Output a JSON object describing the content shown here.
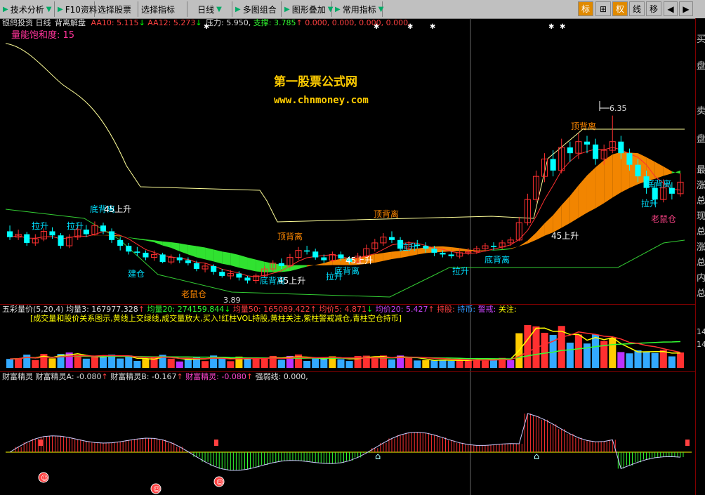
{
  "toolbar": {
    "items": [
      "技术分析",
      "F10资料",
      "选择股票",
      "选择指标",
      "日线",
      "多图组合",
      "图形叠加",
      "常用指标"
    ],
    "right_tools": [
      "标",
      "⊞",
      "权",
      "线",
      "移",
      "◀",
      "▶"
    ]
  },
  "main_chart": {
    "stock_name": "银鸽投资",
    "period": "日线",
    "indicator_name": "背离解盘",
    "aa10_label": "AA10:",
    "aa10_value": "5.115",
    "aa12_label": "AA12:",
    "aa12_value": "5.273",
    "pressure_label": "压力:",
    "pressure_value": "5.950,",
    "support_label": "支撑:",
    "support_value": "3.785",
    "extra_values": "0.000, 0.000, 0.000, 0.000,",
    "saturation_label": "量能饱和度:",
    "saturation_value": "15",
    "watermark_title": "第一股票公式网",
    "watermark_url": "www.chnmoney.com",
    "high_label": "6.35",
    "low_label": "3.89"
  },
  "annotations": [
    {
      "text": "底背离",
      "color": "#00e0ff"
    },
    {
      "text": "45上升",
      "color": "#ffffff"
    },
    {
      "text": "拉升",
      "color": "#00e0ff"
    },
    {
      "text": "拉升",
      "color": "#00e0ff"
    },
    {
      "text": "建仓",
      "color": "#00e0ff"
    },
    {
      "text": "老鼠仓",
      "color": "#ff8800"
    },
    {
      "text": "顶背离",
      "color": "#ff8800"
    },
    {
      "text": "底背离",
      "color": "#00e0ff"
    },
    {
      "text": "45上升",
      "color": "#ffffff"
    },
    {
      "text": "拉升",
      "color": "#00e0ff"
    },
    {
      "text": "底背离",
      "color": "#00e0ff"
    },
    {
      "text": "45上升",
      "color": "#ffffff"
    },
    {
      "text": "顶背离",
      "color": "#ff8800"
    },
    {
      "text": "拉升",
      "color": "#00e0ff"
    },
    {
      "text": "拉升",
      "color": "#00e0ff"
    },
    {
      "text": "底背离",
      "color": "#00e0ff"
    },
    {
      "text": "45上升",
      "color": "#ffffff"
    },
    {
      "text": "顶背离",
      "color": "#ff8800"
    },
    {
      "text": "底背离",
      "color": "#00e0ff"
    },
    {
      "text": "拉升",
      "color": "#00e0ff"
    },
    {
      "text": "老鼠仓",
      "color": "#ff4488"
    }
  ],
  "volume_panel": {
    "title": "五彩量价(5,20,4)",
    "v3_label": "均量3:",
    "v3_value": "167977.328",
    "v20_label": "均量20:",
    "v20_value": "274159.844",
    "v50_label": "均量50:",
    "v50_value": "165089.422",
    "p5_label": "均价5:",
    "p5_value": "4.871",
    "p20_label": "均价20:",
    "p20_value": "5.427",
    "hold_label": "持股:",
    "hold_coin_label": "持币:",
    "warn_label": "警戒:",
    "watch_label": "关注:",
    "note": "[成交量和股价关系图示,黄线上交绿线,成交量放大,买入!红柱VOL持股,黄柱关注,紫柱警戒减仓,青柱空仓持币]"
  },
  "wealth_panel": {
    "title": "财富精灵",
    "a_label": "财富精灵A:",
    "a_value": "-0.080",
    "b_label": "财富精灵B:",
    "b_value": "-0.167",
    "c_label": "财富精灵:",
    "c_value": "-0.080",
    "strength_label": "强弱线:",
    "strength_value": "0.000,"
  },
  "right_panel": {
    "top_chars": [
      "买",
      "盘",
      "卖",
      "盘",
      "最",
      "涨",
      "总",
      "现",
      "总",
      "涨",
      "总",
      "内",
      "总"
    ],
    "axis_values": [
      "14",
      "14"
    ]
  },
  "colors": {
    "up_candle": "#ff3030",
    "down_candle": "#00ffff",
    "band_green": "#33ee33",
    "band_orange": "#ff8c00",
    "panel_border": "#800000"
  },
  "chart_data": {
    "type": "candlestick",
    "candles": [
      [
        4.35,
        4.25,
        4.45,
        4.2
      ],
      [
        4.25,
        4.3,
        4.38,
        4.2
      ],
      [
        4.3,
        4.15,
        4.34,
        4.1
      ],
      [
        4.15,
        4.22,
        4.3,
        4.1
      ],
      [
        4.22,
        4.35,
        4.4,
        4.18
      ],
      [
        4.35,
        4.28,
        4.42,
        4.22
      ],
      [
        4.28,
        4.1,
        4.32,
        4.05
      ],
      [
        4.1,
        4.25,
        4.3,
        4.06
      ],
      [
        4.25,
        4.38,
        4.45,
        4.2
      ],
      [
        4.38,
        4.3,
        4.46,
        4.25
      ],
      [
        4.3,
        4.45,
        4.52,
        4.28
      ],
      [
        4.45,
        4.35,
        4.5,
        4.3
      ],
      [
        4.35,
        4.2,
        4.4,
        4.15
      ],
      [
        4.2,
        4.1,
        4.25,
        4.02
      ],
      [
        4.1,
        4.0,
        4.15,
        3.95
      ],
      [
        4.0,
        3.98,
        4.08,
        3.92
      ],
      [
        3.98,
        3.9,
        4.02,
        3.85
      ],
      [
        3.9,
        3.95,
        4.02,
        3.84
      ],
      [
        3.95,
        3.82,
        3.98,
        3.8
      ],
      [
        3.82,
        3.9,
        3.95,
        3.78
      ],
      [
        3.9,
        3.85,
        3.96,
        3.8
      ],
      [
        3.85,
        3.8,
        3.9,
        3.76
      ],
      [
        3.8,
        3.7,
        3.84,
        3.66
      ],
      [
        3.7,
        3.75,
        3.8,
        3.64
      ],
      [
        3.75,
        3.65,
        3.78,
        3.6
      ],
      [
        3.65,
        3.58,
        3.7,
        3.55
      ],
      [
        3.58,
        3.62,
        3.68,
        3.52
      ],
      [
        3.62,
        3.55,
        3.66,
        3.5
      ],
      [
        3.55,
        3.5,
        3.58,
        3.45
      ],
      [
        3.5,
        3.58,
        3.62,
        3.45
      ],
      [
        3.58,
        3.7,
        3.75,
        3.55
      ],
      [
        3.7,
        3.8,
        3.85,
        3.66
      ],
      [
        3.8,
        3.75,
        3.88,
        3.7
      ],
      [
        3.75,
        3.9,
        3.96,
        3.72
      ],
      [
        3.9,
        4.02,
        4.08,
        3.86
      ],
      [
        4.02,
        4.0,
        4.1,
        3.95
      ],
      [
        4.0,
        3.9,
        4.05,
        3.86
      ],
      [
        3.9,
        3.85,
        3.95,
        3.8
      ],
      [
        3.85,
        3.95,
        4.0,
        3.82
      ],
      [
        3.95,
        3.88,
        4.0,
        3.84
      ],
      [
        3.88,
        3.82,
        3.92,
        3.78
      ],
      [
        3.82,
        3.92,
        3.98,
        3.8
      ],
      [
        3.92,
        4.05,
        4.12,
        3.9
      ],
      [
        4.05,
        4.15,
        4.22,
        4.0
      ],
      [
        4.15,
        4.25,
        4.32,
        4.1
      ],
      [
        4.25,
        4.2,
        4.35,
        4.15
      ],
      [
        4.2,
        4.05,
        4.25,
        4.0
      ],
      [
        4.05,
        4.12,
        4.18,
        4.02
      ],
      [
        4.12,
        4.1,
        4.2,
        4.05
      ],
      [
        4.1,
        4.05,
        4.16,
        3.98
      ],
      [
        4.05,
        3.98,
        4.1,
        3.92
      ],
      [
        3.98,
        3.95,
        4.02,
        3.9
      ],
      [
        3.95,
        3.92,
        4.0,
        3.88
      ],
      [
        3.92,
        3.98,
        4.04,
        3.88
      ],
      [
        3.98,
        4.0,
        4.06,
        3.94
      ],
      [
        4.0,
        4.05,
        4.1,
        3.96
      ],
      [
        4.05,
        4.1,
        4.15,
        4.0
      ],
      [
        4.1,
        4.08,
        4.16,
        4.02
      ],
      [
        4.08,
        4.15,
        4.2,
        4.04
      ],
      [
        4.15,
        4.2,
        4.25,
        4.1
      ],
      [
        4.2,
        4.5,
        4.6,
        4.18
      ],
      [
        4.5,
        4.9,
        5.0,
        4.45
      ],
      [
        4.9,
        5.3,
        5.4,
        4.85
      ],
      [
        5.3,
        5.6,
        5.7,
        5.2
      ],
      [
        5.6,
        5.4,
        5.75,
        5.3
      ],
      [
        5.4,
        5.8,
        5.95,
        5.35
      ],
      [
        5.8,
        5.7,
        5.9,
        5.55
      ],
      [
        5.7,
        5.9,
        6.05,
        5.6
      ],
      [
        5.9,
        5.85,
        6.0,
        5.7
      ],
      [
        5.85,
        5.6,
        5.95,
        5.5
      ],
      [
        5.6,
        5.75,
        5.85,
        5.5
      ],
      [
        5.75,
        5.9,
        6.35,
        5.7
      ],
      [
        5.9,
        5.7,
        6.0,
        5.6
      ],
      [
        5.7,
        5.5,
        5.78,
        5.4
      ],
      [
        5.5,
        5.3,
        5.6,
        5.2
      ],
      [
        5.3,
        5.1,
        5.4,
        5.0
      ],
      [
        5.1,
        4.9,
        5.2,
        4.8
      ],
      [
        4.9,
        5.1,
        5.25,
        4.85
      ],
      [
        5.1,
        5.0,
        5.2,
        4.9
      ],
      [
        5.0,
        5.2,
        5.35,
        4.95
      ]
    ]
  }
}
